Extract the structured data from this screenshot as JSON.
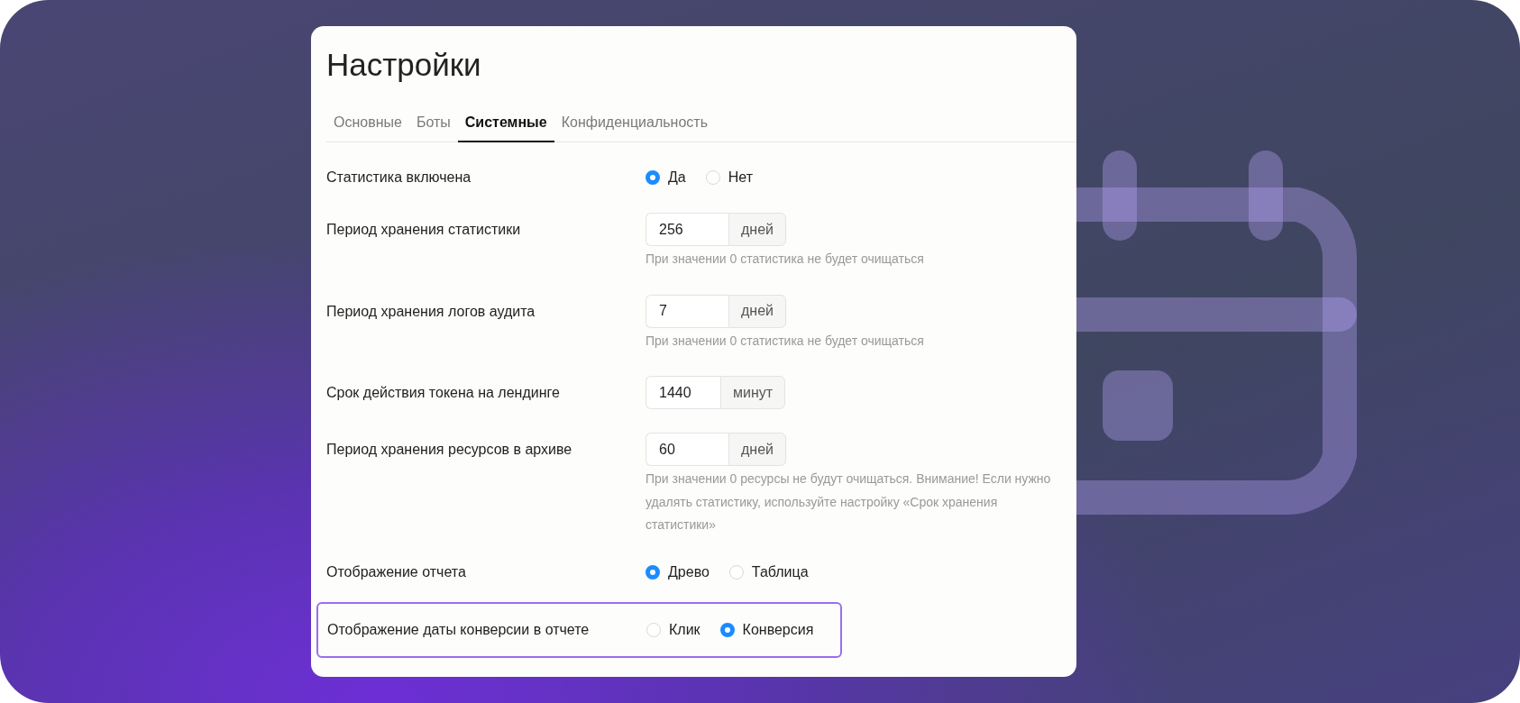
{
  "title": "Настройки",
  "tabs": [
    {
      "label": "Основные",
      "selected": false
    },
    {
      "label": "Боты",
      "selected": false
    },
    {
      "label": "Системные",
      "selected": true
    },
    {
      "label": "Конфиденциальность",
      "selected": false
    }
  ],
  "settings": [
    {
      "kind": "radio",
      "label": "Статистика включена",
      "highlighted": false,
      "options": [
        {
          "label": "Да",
          "selected": true
        },
        {
          "label": "Нет",
          "selected": false
        }
      ]
    },
    {
      "kind": "number",
      "label": "Период хранения статистики",
      "highlighted": false,
      "value": "256",
      "unit": "дней",
      "hint": "При значении 0 статистика не будет очищаться"
    },
    {
      "kind": "number",
      "label": "Период хранения логов аудита",
      "highlighted": false,
      "value": "7",
      "unit": "дней",
      "hint": "При значении 0 статистика не будет очищаться"
    },
    {
      "kind": "number",
      "label": "Срок действия токена на лендинге",
      "highlighted": false,
      "value": "1440",
      "unit": "минут"
    },
    {
      "kind": "number",
      "label": "Период хранения ресурсов в архиве",
      "highlighted": false,
      "value": "60",
      "unit": "дней",
      "hint": "При значении 0 ресурсы не будут очищаться. Внимание! Если нужно удалять статистику, используйте настройку «Срок хранения статистики»"
    },
    {
      "kind": "radio",
      "label": "Отображение отчета",
      "highlighted": false,
      "options": [
        {
          "label": "Древо",
          "selected": true
        },
        {
          "label": "Таблица",
          "selected": false
        }
      ]
    },
    {
      "kind": "radio",
      "label": "Отображение даты конверсии в отчете",
      "highlighted": true,
      "options": [
        {
          "label": "Клик",
          "selected": false
        },
        {
          "label": "Конверсия",
          "selected": true
        }
      ]
    }
  ]
}
